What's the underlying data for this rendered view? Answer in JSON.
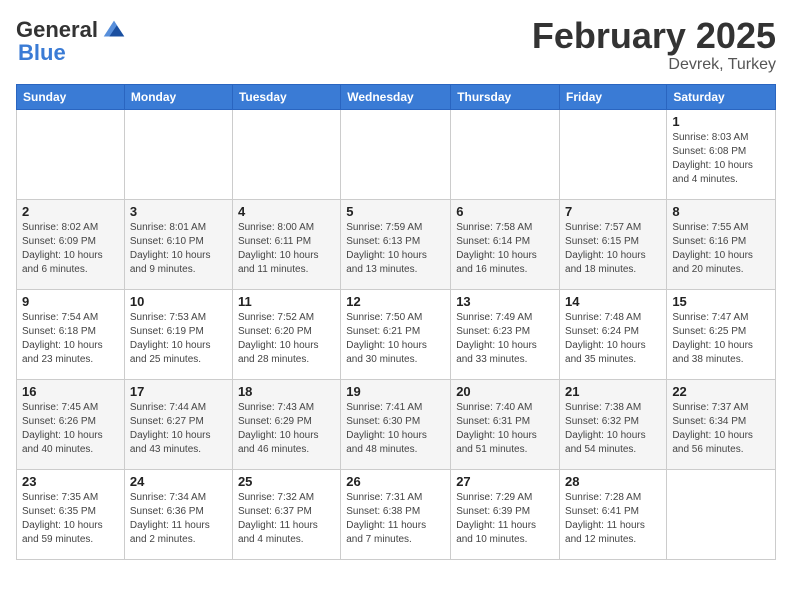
{
  "logo": {
    "general": "General",
    "blue": "Blue"
  },
  "title": {
    "month": "February 2025",
    "location": "Devrek, Turkey"
  },
  "weekdays": [
    "Sunday",
    "Monday",
    "Tuesday",
    "Wednesday",
    "Thursday",
    "Friday",
    "Saturday"
  ],
  "weeks": [
    [
      {
        "day": "",
        "info": ""
      },
      {
        "day": "",
        "info": ""
      },
      {
        "day": "",
        "info": ""
      },
      {
        "day": "",
        "info": ""
      },
      {
        "day": "",
        "info": ""
      },
      {
        "day": "",
        "info": ""
      },
      {
        "day": "1",
        "info": "Sunrise: 8:03 AM\nSunset: 6:08 PM\nDaylight: 10 hours\nand 4 minutes."
      }
    ],
    [
      {
        "day": "2",
        "info": "Sunrise: 8:02 AM\nSunset: 6:09 PM\nDaylight: 10 hours\nand 6 minutes."
      },
      {
        "day": "3",
        "info": "Sunrise: 8:01 AM\nSunset: 6:10 PM\nDaylight: 10 hours\nand 9 minutes."
      },
      {
        "day": "4",
        "info": "Sunrise: 8:00 AM\nSunset: 6:11 PM\nDaylight: 10 hours\nand 11 minutes."
      },
      {
        "day": "5",
        "info": "Sunrise: 7:59 AM\nSunset: 6:13 PM\nDaylight: 10 hours\nand 13 minutes."
      },
      {
        "day": "6",
        "info": "Sunrise: 7:58 AM\nSunset: 6:14 PM\nDaylight: 10 hours\nand 16 minutes."
      },
      {
        "day": "7",
        "info": "Sunrise: 7:57 AM\nSunset: 6:15 PM\nDaylight: 10 hours\nand 18 minutes."
      },
      {
        "day": "8",
        "info": "Sunrise: 7:55 AM\nSunset: 6:16 PM\nDaylight: 10 hours\nand 20 minutes."
      }
    ],
    [
      {
        "day": "9",
        "info": "Sunrise: 7:54 AM\nSunset: 6:18 PM\nDaylight: 10 hours\nand 23 minutes."
      },
      {
        "day": "10",
        "info": "Sunrise: 7:53 AM\nSunset: 6:19 PM\nDaylight: 10 hours\nand 25 minutes."
      },
      {
        "day": "11",
        "info": "Sunrise: 7:52 AM\nSunset: 6:20 PM\nDaylight: 10 hours\nand 28 minutes."
      },
      {
        "day": "12",
        "info": "Sunrise: 7:50 AM\nSunset: 6:21 PM\nDaylight: 10 hours\nand 30 minutes."
      },
      {
        "day": "13",
        "info": "Sunrise: 7:49 AM\nSunset: 6:23 PM\nDaylight: 10 hours\nand 33 minutes."
      },
      {
        "day": "14",
        "info": "Sunrise: 7:48 AM\nSunset: 6:24 PM\nDaylight: 10 hours\nand 35 minutes."
      },
      {
        "day": "15",
        "info": "Sunrise: 7:47 AM\nSunset: 6:25 PM\nDaylight: 10 hours\nand 38 minutes."
      }
    ],
    [
      {
        "day": "16",
        "info": "Sunrise: 7:45 AM\nSunset: 6:26 PM\nDaylight: 10 hours\nand 40 minutes."
      },
      {
        "day": "17",
        "info": "Sunrise: 7:44 AM\nSunset: 6:27 PM\nDaylight: 10 hours\nand 43 minutes."
      },
      {
        "day": "18",
        "info": "Sunrise: 7:43 AM\nSunset: 6:29 PM\nDaylight: 10 hours\nand 46 minutes."
      },
      {
        "day": "19",
        "info": "Sunrise: 7:41 AM\nSunset: 6:30 PM\nDaylight: 10 hours\nand 48 minutes."
      },
      {
        "day": "20",
        "info": "Sunrise: 7:40 AM\nSunset: 6:31 PM\nDaylight: 10 hours\nand 51 minutes."
      },
      {
        "day": "21",
        "info": "Sunrise: 7:38 AM\nSunset: 6:32 PM\nDaylight: 10 hours\nand 54 minutes."
      },
      {
        "day": "22",
        "info": "Sunrise: 7:37 AM\nSunset: 6:34 PM\nDaylight: 10 hours\nand 56 minutes."
      }
    ],
    [
      {
        "day": "23",
        "info": "Sunrise: 7:35 AM\nSunset: 6:35 PM\nDaylight: 10 hours\nand 59 minutes."
      },
      {
        "day": "24",
        "info": "Sunrise: 7:34 AM\nSunset: 6:36 PM\nDaylight: 11 hours\nand 2 minutes."
      },
      {
        "day": "25",
        "info": "Sunrise: 7:32 AM\nSunset: 6:37 PM\nDaylight: 11 hours\nand 4 minutes."
      },
      {
        "day": "26",
        "info": "Sunrise: 7:31 AM\nSunset: 6:38 PM\nDaylight: 11 hours\nand 7 minutes."
      },
      {
        "day": "27",
        "info": "Sunrise: 7:29 AM\nSunset: 6:39 PM\nDaylight: 11 hours\nand 10 minutes."
      },
      {
        "day": "28",
        "info": "Sunrise: 7:28 AM\nSunset: 6:41 PM\nDaylight: 11 hours\nand 12 minutes."
      },
      {
        "day": "",
        "info": ""
      }
    ]
  ]
}
